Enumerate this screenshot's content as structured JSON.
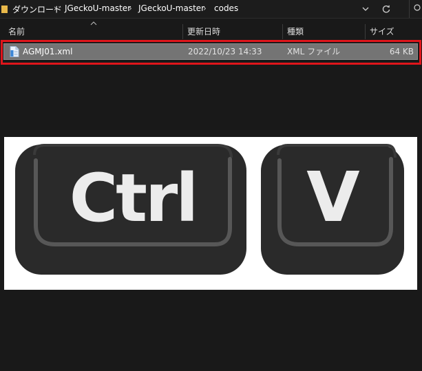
{
  "breadcrumb": {
    "items": [
      "ダウンロード",
      "JGeckoU-master",
      "JGeckoU-master",
      "codes"
    ],
    "separator": "›"
  },
  "columns": {
    "name": "名前",
    "modified": "更新日時",
    "type": "種類",
    "size": "サイズ"
  },
  "files": [
    {
      "name": "AGMJ01.xml",
      "modified": "2022/10/23 14:33",
      "type": "XML ファイル",
      "size": "64 KB"
    }
  ],
  "image": {
    "keys": [
      "Ctrl",
      "V"
    ]
  },
  "colors": {
    "background": "#191919",
    "selected_row": "#747474",
    "highlight": "#e0151b",
    "key_face": "#2a2a2a",
    "key_text": "#ececec"
  }
}
